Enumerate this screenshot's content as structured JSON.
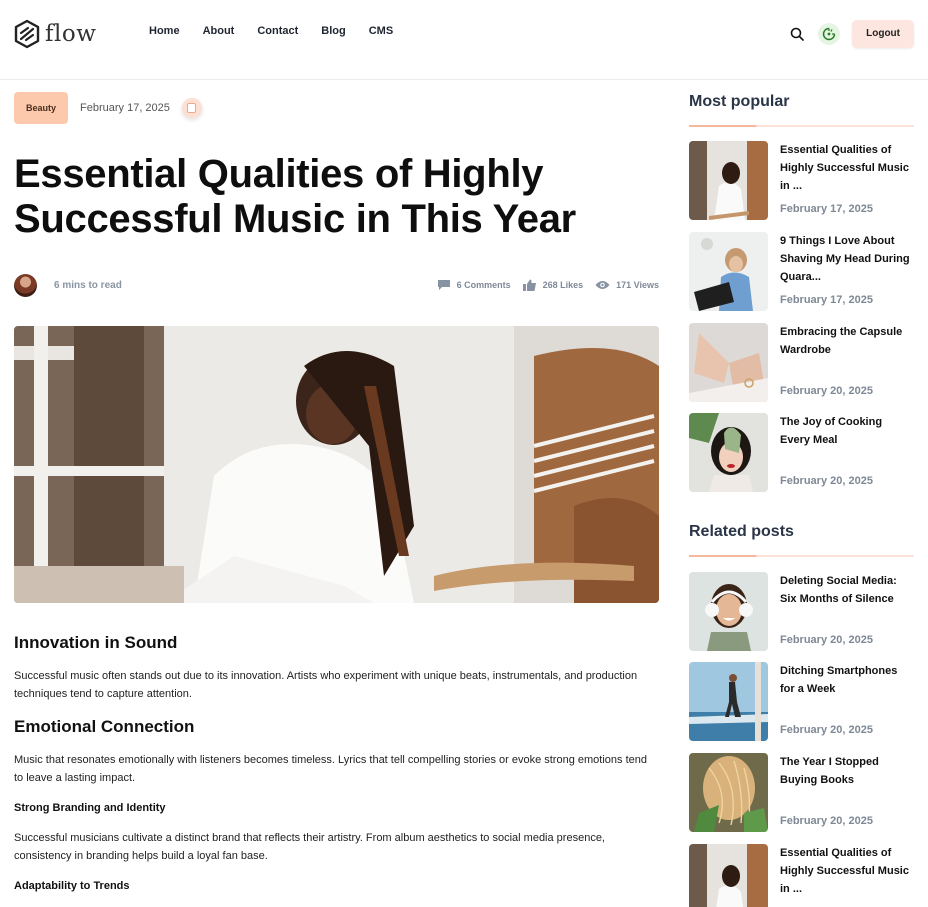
{
  "brand": {
    "name": "flow"
  },
  "nav": [
    "Home",
    "About",
    "Contact",
    "Blog",
    "CMS"
  ],
  "header": {
    "logout_label": "Logout",
    "search_icon": "search-icon",
    "theme_icon": "theme-toggle-icon"
  },
  "article": {
    "category": "Beauty",
    "date": "February 17, 2025",
    "title": "Essential Qualities of Highly Successful Music in This Year",
    "read_time": "6 mins to read",
    "comments": "6 Comments",
    "likes": "268 Likes",
    "views": "171 Views",
    "sections": {
      "h1": "Innovation in Sound",
      "p1": "Successful music often stands out due to its innovation. Artists who experiment with unique beats, instrumentals, and production techniques tend to capture attention.",
      "h2": "Emotional Connection",
      "p2": "Music that resonates emotionally with listeners becomes timeless. Lyrics that tell compelling stories or evoke strong emotions tend to leave a lasting impact.",
      "h3": "Strong Branding and Identity",
      "p3": "Successful musicians cultivate a distinct brand that reflects their artistry. From album aesthetics to social media presence, consistency in branding helps build a loyal fan base.",
      "h4": "Adaptability to Trends"
    }
  },
  "sidebar": {
    "popular_title": "Most popular",
    "popular": [
      {
        "title": "Essential Qualities of Highly Successful Music in ...",
        "date": "February 17, 2025"
      },
      {
        "title": "9 Things I Love About Shaving My Head During Quara...",
        "date": "February 17, 2025"
      },
      {
        "title": "Embracing the Capsule Wardrobe",
        "date": "February 20, 2025"
      },
      {
        "title": "The Joy of Cooking Every Meal",
        "date": "February 20, 2025"
      }
    ],
    "related_title": "Related posts",
    "related": [
      {
        "title": "Deleting Social Media: Six Months of Silence",
        "date": "February 20, 2025"
      },
      {
        "title": "Ditching Smartphones for a Week",
        "date": "February 20, 2025"
      },
      {
        "title": "The Year I Stopped Buying Books",
        "date": "February 20, 2025"
      },
      {
        "title": "Essential Qualities of Highly Successful Music in ...",
        "date": ""
      }
    ]
  },
  "colors": {
    "accent": "#fcc9ac",
    "rule": "#f6b99c",
    "text_muted": "#7e8895"
  }
}
